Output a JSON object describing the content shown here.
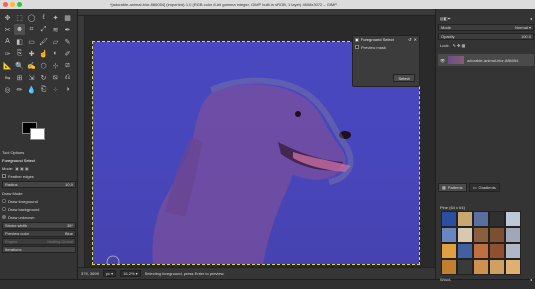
{
  "window": {
    "title": "*[adorable-animal-blur-886054] (imported)-1.0 (RGB color 8-bit gamma integer, GIMP built-in sRGB, 1 layer) 4608x3072 – GIMP",
    "traffic_colors": [
      "#fc5f57",
      "#fdbc2e",
      "#28c840"
    ]
  },
  "toolbox": {
    "tools": [
      {
        "name": "move-tool-icon",
        "glyph": "✥"
      },
      {
        "name": "rect-select-icon",
        "glyph": "⬚"
      },
      {
        "name": "ellipse-select-icon",
        "glyph": "◯"
      },
      {
        "name": "lasso-icon",
        "glyph": "ℓ"
      },
      {
        "name": "fuzzy-select-icon",
        "glyph": "✦"
      },
      {
        "name": "by-color-select-icon",
        "glyph": "▦"
      },
      {
        "name": "scissors-icon",
        "glyph": "✂"
      },
      {
        "name": "foreground-select-icon",
        "glyph": "☻",
        "active": true
      },
      {
        "name": "crop-icon",
        "glyph": "⌗"
      },
      {
        "name": "unified-transform-icon",
        "glyph": "⤢"
      },
      {
        "name": "warp-icon",
        "glyph": "≋"
      },
      {
        "name": "paths-icon",
        "glyph": "✒"
      },
      {
        "name": "text-icon",
        "glyph": "A"
      },
      {
        "name": "bucket-fill-icon",
        "glyph": "◧"
      },
      {
        "name": "gradient-icon",
        "glyph": "▭"
      },
      {
        "name": "paintbrush-icon",
        "glyph": "🖌"
      },
      {
        "name": "eraser-icon",
        "glyph": "▱"
      },
      {
        "name": "airbrush-icon",
        "glyph": "✎"
      },
      {
        "name": "ink-icon",
        "glyph": "✑"
      },
      {
        "name": "clone-icon",
        "glyph": "⎘"
      },
      {
        "name": "heal-icon",
        "glyph": "✚"
      },
      {
        "name": "smudge-icon",
        "glyph": "☝"
      },
      {
        "name": "dodge-burn-icon",
        "glyph": "◐"
      },
      {
        "name": "color-picker-icon",
        "glyph": "✐"
      },
      {
        "name": "measure-icon",
        "glyph": "📐"
      },
      {
        "name": "zoom-icon",
        "glyph": "🔍"
      },
      {
        "name": "mypaint-brush-icon",
        "glyph": "✍"
      },
      {
        "name": "cage-transform-icon",
        "glyph": "⬡"
      },
      {
        "name": "handle-transform-icon",
        "glyph": "⊹"
      },
      {
        "name": "perspective-icon",
        "glyph": "⧄"
      },
      {
        "name": "flip-icon",
        "glyph": "⇋"
      },
      {
        "name": "align-icon",
        "glyph": "⊞"
      },
      {
        "name": "scale-icon",
        "glyph": "⇲"
      },
      {
        "name": "rotate-icon",
        "glyph": "↻"
      },
      {
        "name": "shear-icon",
        "glyph": "⧅"
      },
      {
        "name": "seamless-clone-icon",
        "glyph": "⎌"
      },
      {
        "name": "gegl-icon",
        "glyph": "◎"
      },
      {
        "name": "pencil-icon",
        "glyph": "✏"
      },
      {
        "name": "blur-icon",
        "glyph": "💧"
      },
      {
        "name": "perspective-clone-icon",
        "glyph": "⎗"
      },
      {
        "name": "n-point-icon",
        "glyph": "⁘"
      },
      {
        "name": "threshold-icon",
        "glyph": "◑"
      }
    ]
  },
  "tool_options": {
    "tab_label": "Tool Options",
    "section_title": "Foreground Select",
    "mode_label": "Mode:",
    "feather_label": "Feather edges",
    "radius_label": "Radius",
    "radius_value": "10.0",
    "draw_mode_label": "Draw Mode",
    "draw_foreground": "Draw foreground",
    "draw_background": "Draw background",
    "draw_unknown": "Draw unknown",
    "stroke_width_label": "Stroke width",
    "stroke_width_value": "35*",
    "preview_color_label": "Preview color",
    "preview_color_value": "Blue",
    "engine_label": "Engine",
    "engine_value": "Matting Global",
    "iterations_label": "Iterations"
  },
  "dialog": {
    "title": "Foreground Select",
    "preview_mask_label": "Preview mask",
    "select_label": "Select"
  },
  "status": {
    "coordinates": "379, 3699",
    "unit": "px",
    "zoom": "16.2%",
    "message": "Selecting foreground, press Enter to preview."
  },
  "right_dock": {
    "mode_label": "Mode",
    "mode_value": "Normal",
    "opacity_label": "Opacity",
    "opacity_value": "100.0",
    "lock_label": "Lock:",
    "layer_name": "adorable-animal-blur-886054",
    "patterns_tab": "Patterns",
    "gradients_tab": "Gradients",
    "pattern_name": "Pine (64 x 64)",
    "pattern_footer": "Wood,"
  },
  "colors": {
    "canvas_overlay": "#4a48c0",
    "active_tool_bg": "#4e4e4e",
    "selection_outline": "#d8d860"
  }
}
